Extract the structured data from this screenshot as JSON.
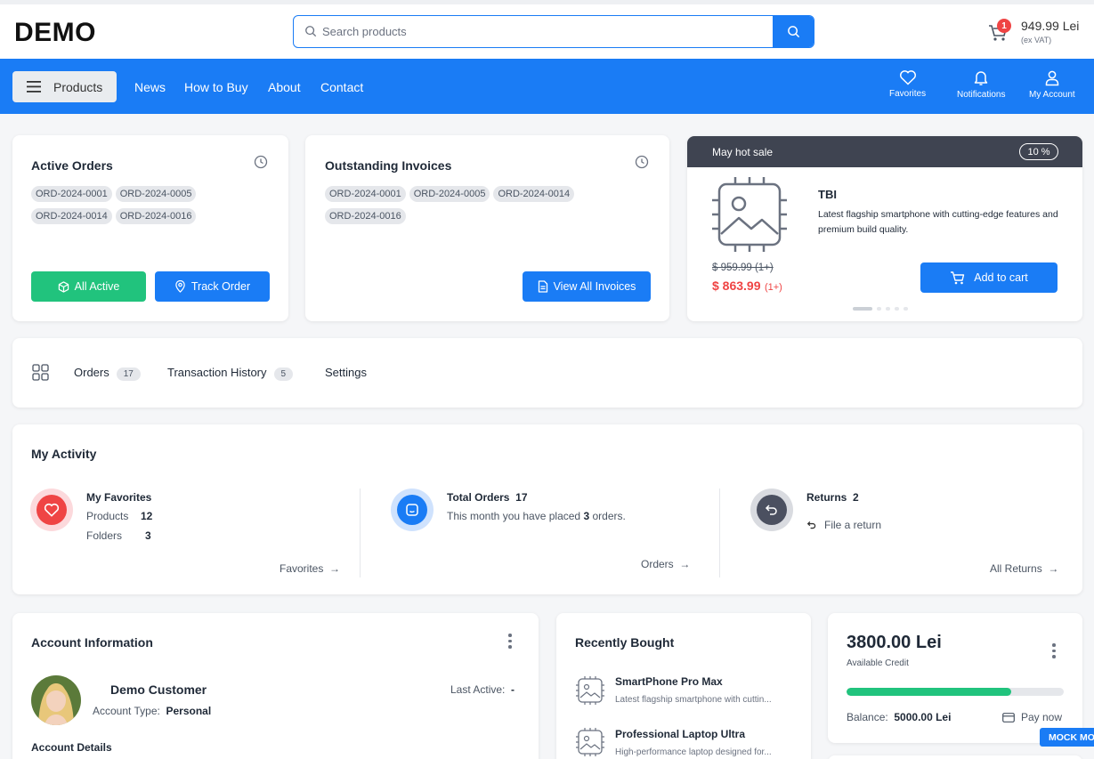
{
  "header": {
    "logo": "DEMO",
    "search_placeholder": "Search products",
    "cart_count": "1",
    "cart_total": "949.99 Lei",
    "cart_vat": "(ex VAT)"
  },
  "nav": {
    "products_label": "Products",
    "links": [
      "News",
      "How to Buy",
      "About",
      "Contact"
    ],
    "favorites": "Favorites",
    "notifications": "Notifications",
    "account": "My Account"
  },
  "active_orders": {
    "title": "Active Orders",
    "orders": [
      "ORD-2024-0001",
      "ORD-2024-0005",
      "ORD-2024-0014",
      "ORD-2024-0016"
    ],
    "btn_all": "All Active",
    "btn_track": "Track Order"
  },
  "invoices": {
    "title": "Outstanding Invoices",
    "invoices": [
      "ORD-2024-0001",
      "ORD-2024-0005",
      "ORD-2024-0014",
      "ORD-2024-0016"
    ],
    "btn_view": "View All Invoices"
  },
  "hot_sale": {
    "title": "May hot sale",
    "discount": "10 %",
    "product_name": "TBI",
    "description": "Latest flagship smartphone with cutting-edge features and premium build quality.",
    "old_price": "$ 959.99 (1+)",
    "new_price": "$ 863.99",
    "new_price_qty": "(1+)",
    "add_to_cart": "Add to cart"
  },
  "tabs": {
    "items": [
      {
        "label": "Orders",
        "count": "17"
      },
      {
        "label": "Transaction History",
        "count": "5"
      },
      {
        "label": "Settings"
      }
    ]
  },
  "activity": {
    "title": "My Activity",
    "favorites": {
      "title": "My Favorites",
      "products_label": "Products",
      "products_count": "12",
      "folders_label": "Folders",
      "folders_count": "3",
      "link": "Favorites"
    },
    "orders": {
      "title": "Total Orders",
      "count": "17",
      "text_pre": "This month you have placed",
      "month_count": "3",
      "text_post": "orders.",
      "link": "Orders"
    },
    "returns": {
      "title": "Returns",
      "count": "2",
      "file_return": "File a return",
      "link": "All Returns"
    }
  },
  "account": {
    "title": "Account Information",
    "name": "Demo Customer",
    "last_active_label": "Last Active:",
    "last_active_value": "-",
    "account_type_label": "Account Type:",
    "account_type_value": "Personal",
    "details_title": "Account Details"
  },
  "recent": {
    "title": "Recently Bought",
    "items": [
      {
        "name": "SmartPhone Pro Max",
        "desc": "Latest flagship smartphone with cuttin..."
      },
      {
        "name": "Professional Laptop Ultra",
        "desc": "High-performance laptop designed for..."
      }
    ]
  },
  "credit": {
    "amount": "3800.00 Lei",
    "label": "Available Credit",
    "progress": 0.76,
    "balance_label": "Balance:",
    "balance_value": "5000.00 Lei",
    "pay_now": "Pay now",
    "mock_badge": "MOCK MO"
  },
  "colors": {
    "brand": "#1a7cf5",
    "success": "#21c37d",
    "danger": "#ef4444",
    "dark": "#3f4451"
  }
}
